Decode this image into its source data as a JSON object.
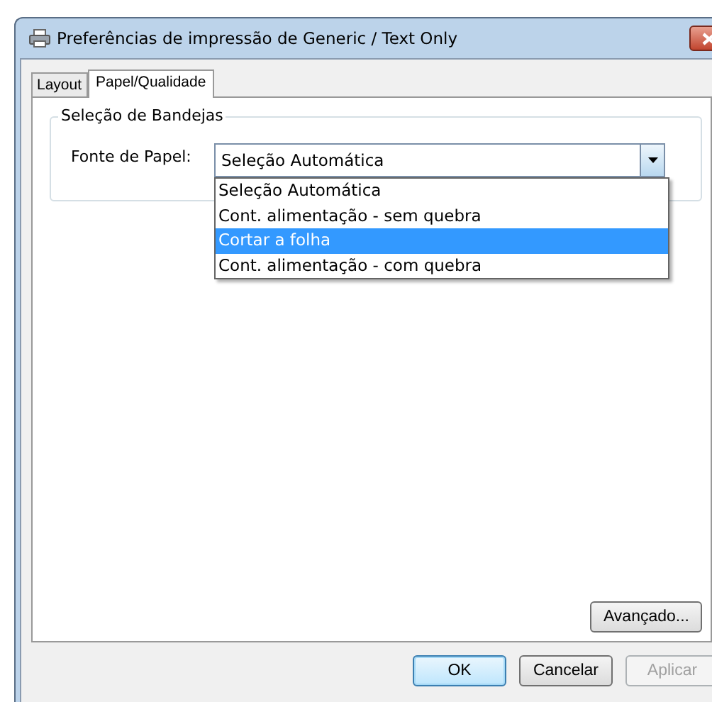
{
  "window": {
    "title": "Preferências de impressão de Generic / Text Only"
  },
  "tabs": [
    {
      "label": "Layout",
      "selected": false
    },
    {
      "label": "Papel/Qualidade",
      "selected": true
    }
  ],
  "group": {
    "title": "Seleção de Bandejas",
    "field_label": "Fonte de Papel:",
    "value": "Seleção Automática",
    "dropdown": [
      {
        "label": "Seleção Automática",
        "highlighted": false
      },
      {
        "label": "Cont. alimentação - sem quebra",
        "highlighted": false
      },
      {
        "label": "Cortar a folha",
        "highlighted": true
      },
      {
        "label": "Cont. alimentação - com quebra",
        "highlighted": false
      }
    ]
  },
  "advanced_button": {
    "label": "Avançado...",
    "disabled": false
  },
  "buttons": [
    {
      "label": "OK",
      "default": true,
      "disabled": false
    },
    {
      "label": "Cancelar",
      "default": false,
      "disabled": false
    },
    {
      "label": "Aplicar",
      "default": false,
      "disabled": true
    }
  ]
}
